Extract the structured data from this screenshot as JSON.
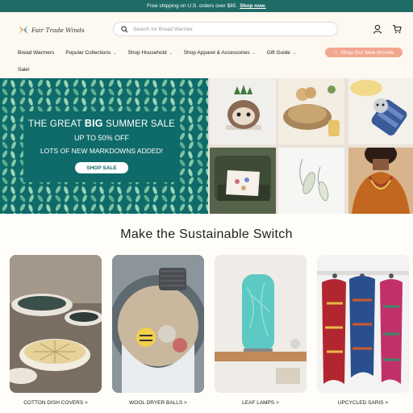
{
  "announcement": {
    "text": "Free shipping on U.S. orders over $85.",
    "link": "Shop now."
  },
  "header": {
    "logo_text": "Fair Trade Winds",
    "search_placeholder": "Search for Bread Warmer"
  },
  "nav": {
    "items": [
      {
        "label": "Bread Warmers",
        "dropdown": false
      },
      {
        "label": "Popular Collections",
        "dropdown": true
      },
      {
        "label": "Shop Household",
        "dropdown": true
      },
      {
        "label": "Shop Apparel & Accessories",
        "dropdown": true
      },
      {
        "label": "Gift Guide",
        "dropdown": true
      }
    ],
    "cta": "Shop Our New Arrivals",
    "sale": "Sale!"
  },
  "hero": {
    "line1_pre": "THE GREAT",
    "line1_bold": "BIG",
    "line1_post": "SUMMER SALE",
    "line2": "UP TO 50% OFF",
    "line3": "LOTS OF NEW MARKDOWNS ADDED!",
    "button": "SHOP SALE"
  },
  "section": {
    "title": "Make the Sustainable Switch"
  },
  "categories": [
    {
      "label": "COTTON DISH COVERS >"
    },
    {
      "label": "WOOL DRYER BALLS >"
    },
    {
      "label": "LEAF LAMPS >"
    },
    {
      "label": "UPCYCLED SARIS >"
    }
  ],
  "colors": {
    "brand_teal": "#1f6b66",
    "cta_peach": "#f2a78e",
    "banner_teal": "#0f6b69",
    "leaf_green": "#6fb79a"
  }
}
